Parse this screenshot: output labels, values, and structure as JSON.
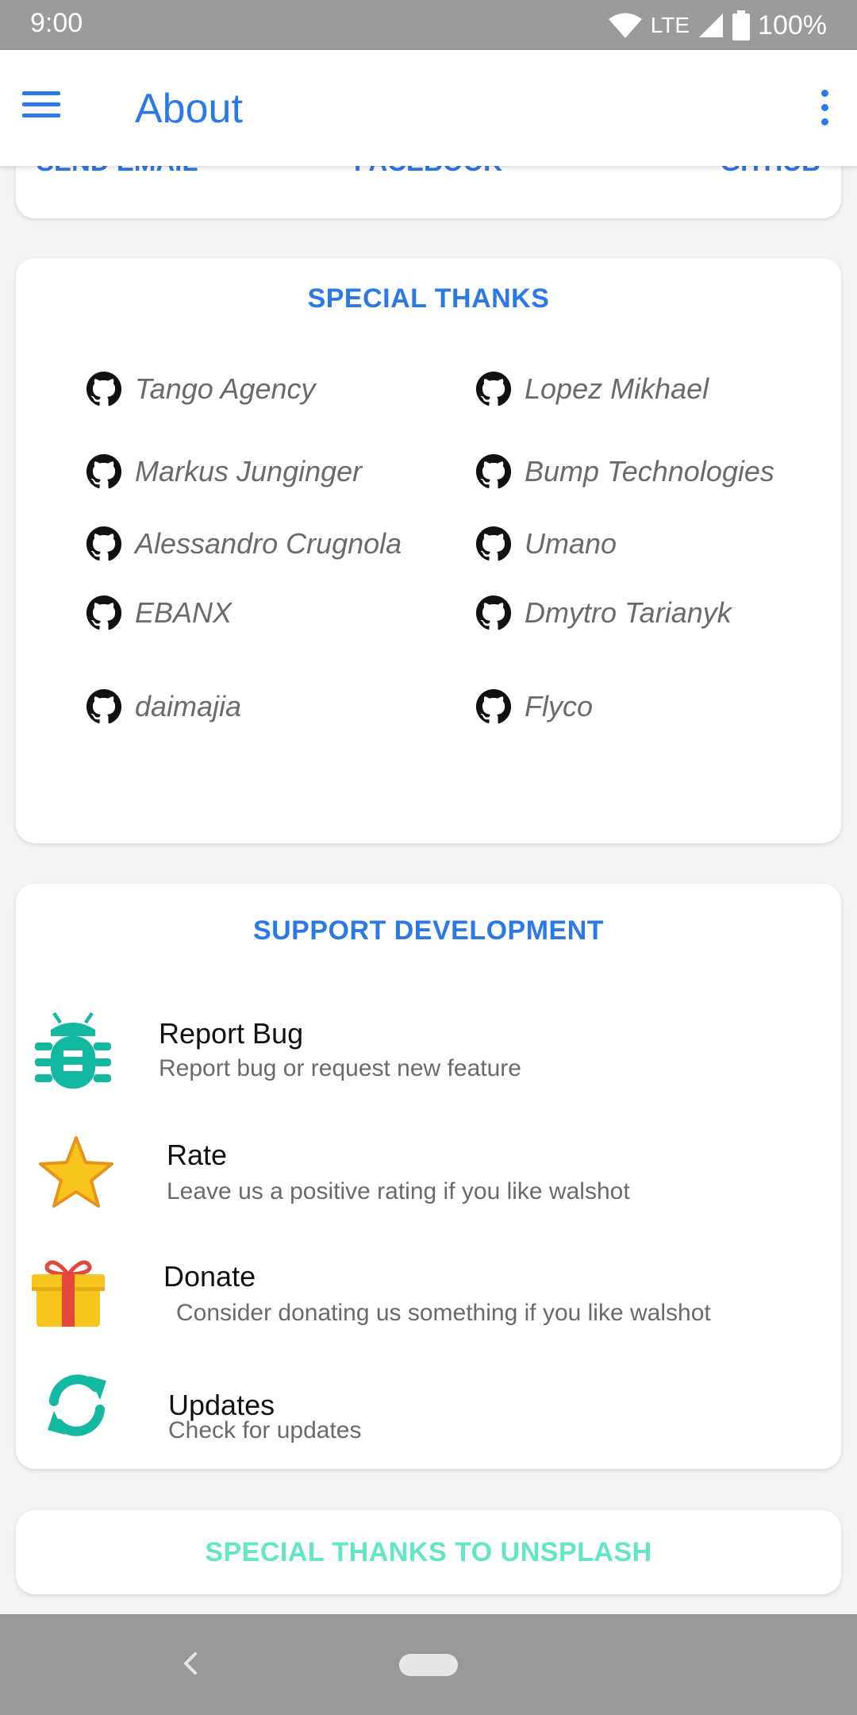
{
  "status_bar": {
    "time": "9:00",
    "network": "LTE",
    "battery": "100%",
    "icons": [
      "wifi-icon",
      "cell-signal-icon",
      "battery-icon"
    ]
  },
  "app_bar": {
    "title": "About",
    "menu_icon": "menu-icon",
    "overflow_icon": "more-vert-icon"
  },
  "links": {
    "send_email": "SEND EMAIL",
    "facebook": "FACEBOOK",
    "github": "GITHUB"
  },
  "special_thanks": {
    "title": "SPECIAL THANKS",
    "icon": "github-icon",
    "people": [
      "Tango Agency",
      "Lopez Mikhael",
      "Markus Junginger",
      "Bump Technologies",
      "Alessandro Crugnola",
      "Umano",
      "EBANX",
      "Dmytro Tarianyk",
      "daimajia",
      "Flyco"
    ]
  },
  "support": {
    "title": "SUPPORT DEVELOPMENT",
    "items": [
      {
        "title": "Report Bug",
        "subtitle": "Report bug or request new feature",
        "icon": "bug-icon"
      },
      {
        "title": "Rate",
        "subtitle": "Leave us a positive rating if you like walshot",
        "icon": "star-icon"
      },
      {
        "title": "Donate",
        "subtitle": "Consider donating us something if you like walshot",
        "icon": "gift-icon"
      },
      {
        "title": "Updates",
        "subtitle": "Check for updates",
        "icon": "refresh-icon"
      }
    ]
  },
  "unsplash": {
    "label": "SPECIAL THANKS TO UNSPLASH"
  },
  "colors": {
    "accent": "#2b79e9",
    "teal": "#12b89f",
    "unsplash_text": "#63e6c6",
    "star": "#f7c51d",
    "gift_ribbon": "#e5483b"
  }
}
